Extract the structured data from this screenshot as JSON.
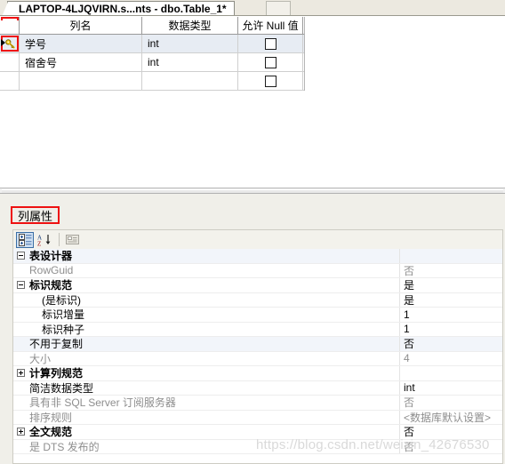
{
  "window": {
    "tab_title": "LAPTOP-4LJQVIRN.s...nts - dbo.Table_1*"
  },
  "column_grid": {
    "headers": [
      "",
      "列名",
      "数据类型",
      "允许 Null 值"
    ],
    "rows": [
      {
        "name": "学号",
        "type": "int",
        "allow_null": false,
        "primary_key": true,
        "selected": true
      },
      {
        "name": "宿舍号",
        "type": "int",
        "allow_null": false,
        "primary_key": false,
        "selected": false
      },
      {
        "name": "",
        "type": "",
        "allow_null": false,
        "primary_key": false,
        "selected": false
      }
    ]
  },
  "properties_pane": {
    "title": "列属性",
    "toolbar": [
      {
        "name": "categorized-view-button",
        "glyph": "categorized-icon",
        "active": true
      },
      {
        "name": "alphabetical-sort-button",
        "glyph": "sort-az-icon",
        "active": false
      },
      {
        "name": "property-pages-button",
        "glyph": "property-pages-icon",
        "active": false
      }
    ],
    "rows": [
      {
        "label": "表设计器",
        "value": "",
        "kind": "category",
        "expander": "minus",
        "indent": 0,
        "shade": true,
        "dim": false,
        "dim_value": false
      },
      {
        "label": "RowGuid",
        "value": "否",
        "kind": "prop",
        "expander": "",
        "indent": 1,
        "shade": false,
        "dim": true,
        "dim_value": true
      },
      {
        "label": "标识规范",
        "value": "是",
        "kind": "category",
        "expander": "minus",
        "indent": 0,
        "shade": false,
        "dim": false,
        "dim_value": false
      },
      {
        "label": "(是标识)",
        "value": "是",
        "kind": "prop",
        "expander": "",
        "indent": 2,
        "shade": false,
        "dim": false,
        "dim_value": false
      },
      {
        "label": "标识增量",
        "value": "1",
        "kind": "prop",
        "expander": "",
        "indent": 2,
        "shade": false,
        "dim": false,
        "dim_value": false
      },
      {
        "label": "标识种子",
        "value": "1",
        "kind": "prop",
        "expander": "",
        "indent": 2,
        "shade": false,
        "dim": false,
        "dim_value": false
      },
      {
        "label": "不用于复制",
        "value": "否",
        "kind": "prop",
        "expander": "",
        "indent": 1,
        "shade": true,
        "dim": false,
        "dim_value": false
      },
      {
        "label": "大小",
        "value": "4",
        "kind": "prop",
        "expander": "",
        "indent": 1,
        "shade": false,
        "dim": true,
        "dim_value": true
      },
      {
        "label": "计算列规范",
        "value": "",
        "kind": "category",
        "expander": "plus",
        "indent": 0,
        "shade": false,
        "dim": false,
        "dim_value": false
      },
      {
        "label": "简洁数据类型",
        "value": "int",
        "kind": "prop",
        "expander": "",
        "indent": 1,
        "shade": false,
        "dim": false,
        "dim_value": false
      },
      {
        "label": "具有非 SQL Server 订阅服务器",
        "value": "否",
        "kind": "prop",
        "expander": "",
        "indent": 1,
        "shade": false,
        "dim": true,
        "dim_value": true
      },
      {
        "label": "排序规则",
        "value": "<数据库默认设置>",
        "kind": "prop",
        "expander": "",
        "indent": 1,
        "shade": false,
        "dim": true,
        "dim_value": true
      },
      {
        "label": "全文规范",
        "value": "否",
        "kind": "category",
        "expander": "plus",
        "indent": 0,
        "shade": false,
        "dim": false,
        "dim_value": false
      },
      {
        "label": "是 DTS 发布的",
        "value": "否",
        "kind": "prop",
        "expander": "",
        "indent": 1,
        "shade": false,
        "dim": true,
        "dim_value": true
      }
    ]
  },
  "watermark": {
    "text": "https://blog.csdn.net/weixin_42676530"
  }
}
